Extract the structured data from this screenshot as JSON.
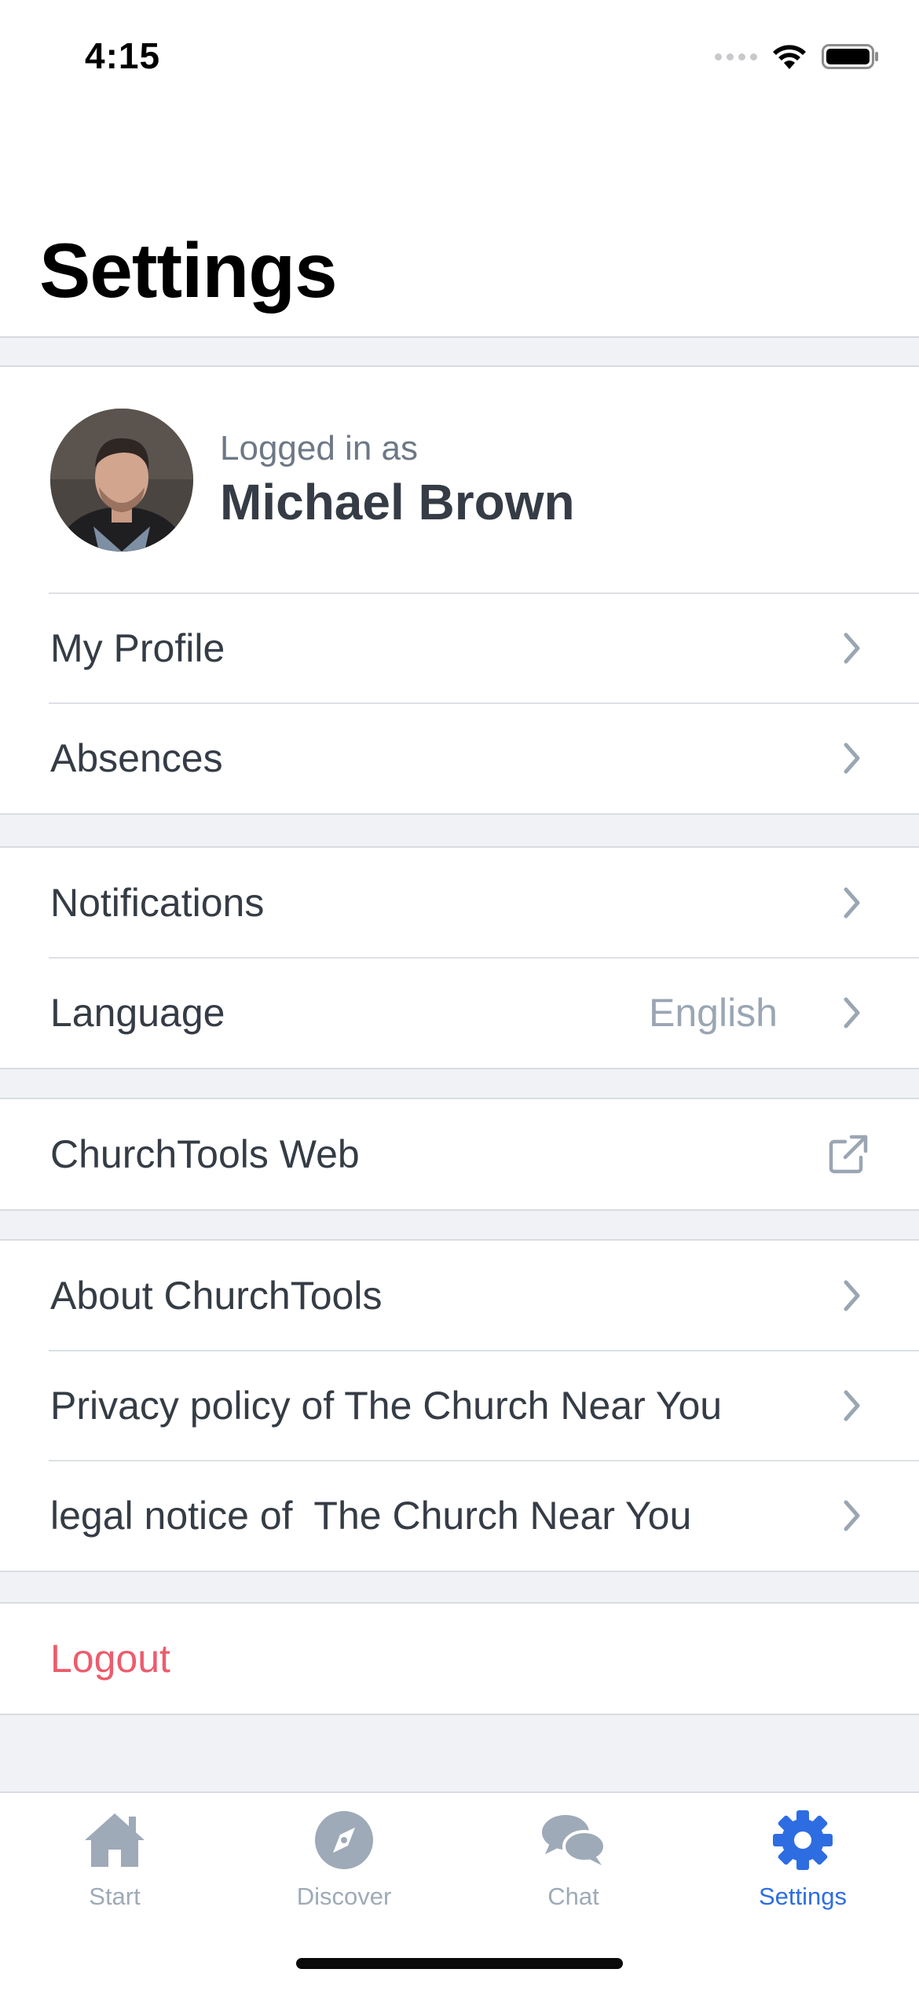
{
  "status_bar": {
    "time": "4:15"
  },
  "header": {
    "title": "Settings"
  },
  "profile": {
    "logged_in_caption": "Logged in as",
    "name": "Michael Brown",
    "avatar_icon": "user-avatar-photo"
  },
  "account_section": {
    "items": [
      {
        "label": "My Profile",
        "icon": "chevron-right-icon"
      },
      {
        "label": "Absences",
        "icon": "chevron-right-icon"
      }
    ]
  },
  "preferences_section": {
    "items": [
      {
        "label": "Notifications",
        "icon": "chevron-right-icon"
      },
      {
        "label": "Language",
        "value": "English",
        "icon": "chevron-right-icon"
      }
    ]
  },
  "web_section": {
    "items": [
      {
        "label": "ChurchTools Web",
        "icon": "external-link-icon"
      }
    ]
  },
  "info_section": {
    "items": [
      {
        "label": "About ChurchTools",
        "icon": "chevron-right-icon"
      },
      {
        "label": "Privacy policy of The Church Near You",
        "icon": "chevron-right-icon"
      },
      {
        "label": "legal notice of  The Church Near You",
        "icon": "chevron-right-icon"
      }
    ]
  },
  "logout": {
    "label": "Logout",
    "color": "#ec5c6c"
  },
  "tabbar": {
    "tabs": [
      {
        "label": "Start",
        "icon": "home-icon",
        "active": false
      },
      {
        "label": "Discover",
        "icon": "compass-icon",
        "active": false
      },
      {
        "label": "Chat",
        "icon": "chat-bubbles-icon",
        "active": false
      },
      {
        "label": "Settings",
        "icon": "gear-icon",
        "active": true
      }
    ]
  },
  "colors": {
    "accent": "#2e6de1",
    "danger": "#ec5c6c",
    "background": "#f0f2f6",
    "inactive_icon": "#9eaab8"
  }
}
